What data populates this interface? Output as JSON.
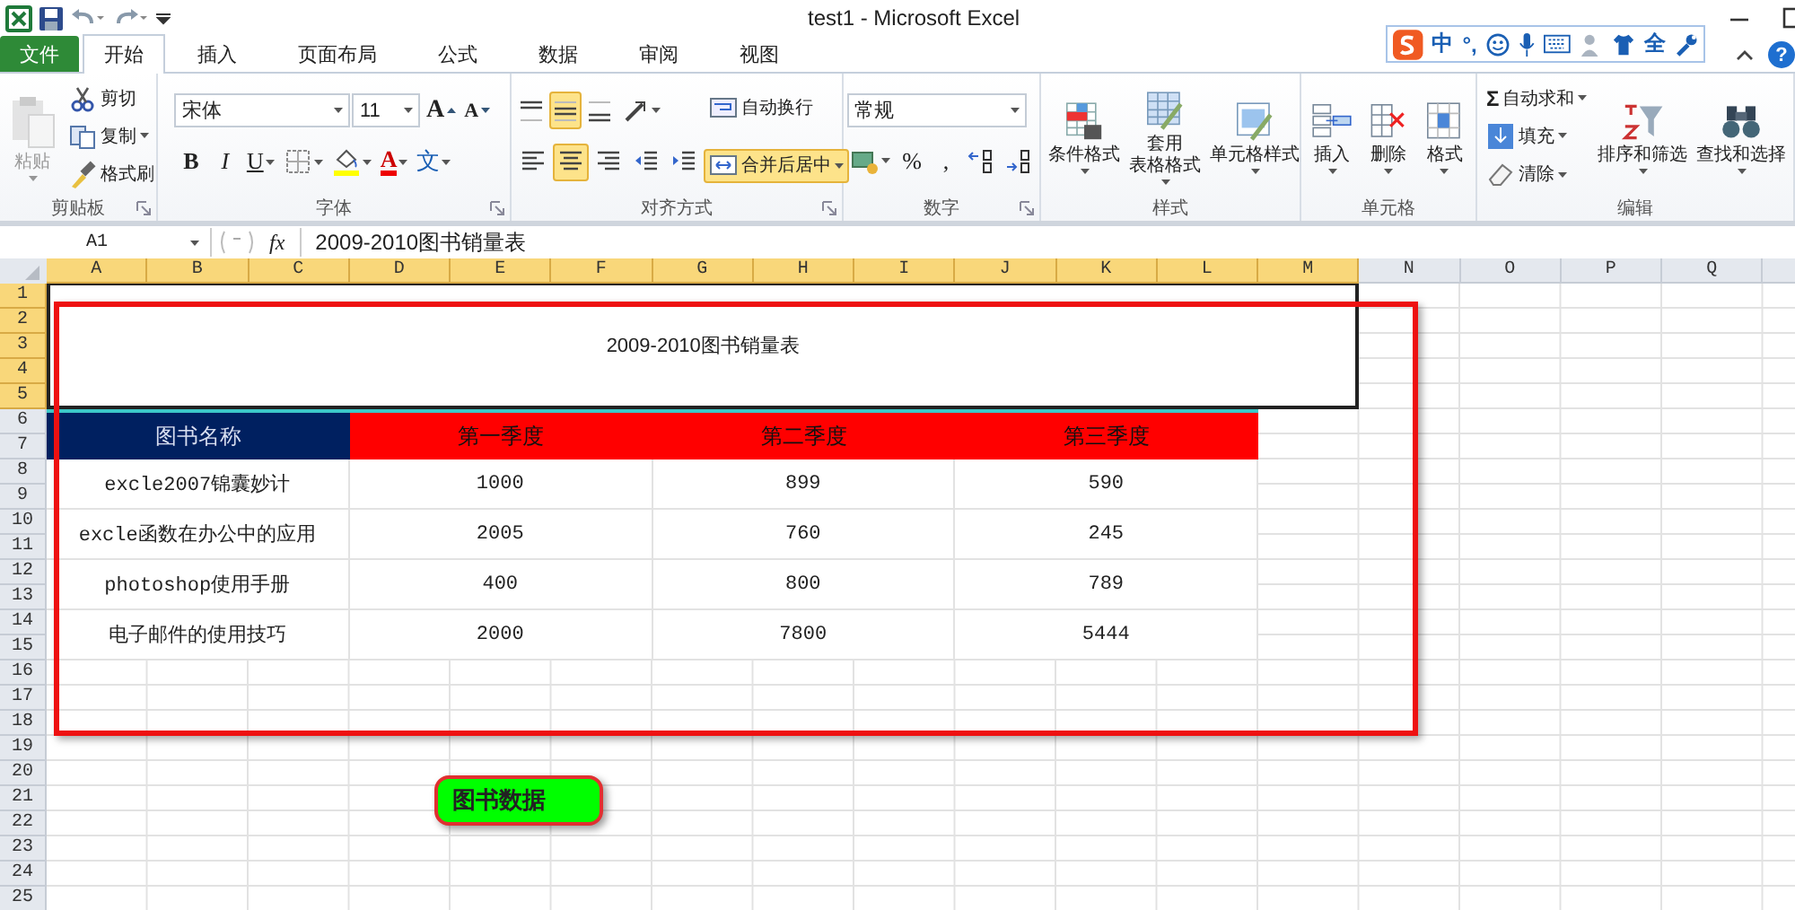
{
  "window": {
    "title": "test1 - Microsoft Excel"
  },
  "ime_toolbar": {
    "items": [
      "中",
      "°,",
      "全"
    ]
  },
  "help": {
    "text": "?"
  },
  "tabs": [
    {
      "label": "文件",
      "kind": "file",
      "selected": false
    },
    {
      "label": "开始",
      "kind": "tab",
      "selected": true
    },
    {
      "label": "插入",
      "kind": "tab",
      "selected": false
    },
    {
      "label": "页面布局",
      "kind": "tab",
      "selected": false
    },
    {
      "label": "公式",
      "kind": "tab",
      "selected": false
    },
    {
      "label": "数据",
      "kind": "tab",
      "selected": false
    },
    {
      "label": "审阅",
      "kind": "tab",
      "selected": false
    },
    {
      "label": "视图",
      "kind": "tab",
      "selected": false
    }
  ],
  "ribbon": [
    {
      "label": "剪贴板",
      "launcher": true,
      "stacks": [
        [
          [
            {
              "kind": "large",
              "label": "粘贴",
              "disabled": true,
              "dropdown": true
            }
          ]
        ],
        [
          [
            {
              "kind": "small",
              "label": "剪切"
            }
          ],
          [
            {
              "kind": "small",
              "label": "复制",
              "dropdown": true
            }
          ],
          [
            {
              "kind": "small",
              "label": "格式刷"
            }
          ]
        ]
      ]
    },
    {
      "label": "字体",
      "launcher": true,
      "stacks": [
        [
          [
            {
              "kind": "font-combo",
              "value": "宋体"
            },
            {
              "kind": "size-combo",
              "value": "11"
            },
            {
              "kind": "tool",
              "text": "A"
            },
            {
              "kind": "tool",
              "text": "A"
            }
          ],
          [
            {
              "kind": "tool",
              "text": "B"
            },
            {
              "kind": "tool",
              "text": "I"
            },
            {
              "kind": "tool",
              "text": "U",
              "dropdown": true
            },
            {
              "kind": "tool",
              "dropdown": true
            },
            {
              "kind": "tool",
              "dropdown": true
            },
            {
              "kind": "tool",
              "text": "A",
              "dropdown": true
            },
            {
              "kind": "tool",
              "text": "文",
              "dropdown": true
            }
          ]
        ]
      ]
    },
    {
      "label": "对齐方式",
      "launcher": true,
      "stacks": [
        [
          [
            {
              "kind": "tool",
              "selected": false
            },
            {
              "kind": "tool",
              "selected": true
            },
            {
              "kind": "tool",
              "selected": false
            },
            {
              "kind": "tool",
              "selected": false,
              "dropdown": true
            }
          ],
          [
            {
              "kind": "tool",
              "selected": false
            },
            {
              "kind": "tool",
              "selected": true
            },
            {
              "kind": "tool",
              "selected": false
            },
            {
              "kind": "tool",
              "selected": false
            },
            {
              "kind": "tool",
              "selected": false
            }
          ]
        ],
        [
          [
            {
              "kind": "small",
              "label": "自动换行",
              "selected": false
            }
          ],
          [
            {
              "kind": "small",
              "label": "合并后居中",
              "selected": true,
              "dropdown": true
            }
          ]
        ]
      ]
    },
    {
      "label": "数字",
      "launcher": true,
      "stacks": [
        [
          [
            {
              "kind": "number-combo",
              "value": "常规"
            }
          ],
          [
            {
              "kind": "tool",
              "dropdown": true
            },
            {
              "kind": "tool",
              "text": "%"
            },
            {
              "kind": "tool",
              "text": ","
            },
            {
              "kind": "tool"
            },
            {
              "kind": "tool"
            }
          ]
        ]
      ]
    },
    {
      "label": "样式",
      "launcher": false,
      "stacks": [
        [
          [
            {
              "kind": "large",
              "label": "条件格式",
              "dropdown": true
            }
          ]
        ],
        [
          [
            {
              "kind": "large",
              "label": [
                "套用",
                "表格格式"
              ],
              "dropdown": true
            }
          ]
        ],
        [
          [
            {
              "kind": "large",
              "label": "单元格样式",
              "dropdown": true
            }
          ]
        ]
      ]
    },
    {
      "label": "单元格",
      "launcher": false,
      "stacks": [
        [
          [
            {
              "kind": "large",
              "label": "插入",
              "dropdown": true
            }
          ]
        ],
        [
          [
            {
              "kind": "large",
              "label": "删除",
              "dropdown": true
            }
          ]
        ],
        [
          [
            {
              "kind": "large",
              "label": "格式",
              "dropdown": true
            }
          ]
        ]
      ]
    },
    {
      "label": "编辑",
      "launcher": false,
      "stacks": [
        [
          [
            {
              "kind": "small",
              "label": "自动求和",
              "glyph": "Σ",
              "dropdown": true
            }
          ],
          [
            {
              "kind": "small",
              "label": "填充",
              "dropdown": true
            }
          ],
          [
            {
              "kind": "small",
              "label": "清除",
              "dropdown": true
            }
          ]
        ],
        [
          [
            {
              "kind": "large",
              "label": "排序和筛选",
              "dropdown": true
            }
          ]
        ],
        [
          [
            {
              "kind": "large",
              "label": "查找和选择",
              "dropdown": true
            }
          ]
        ]
      ]
    }
  ],
  "formula_bar": {
    "name_box": "A1",
    "function_label": "fx",
    "formula": "2009-2010图书销量表"
  },
  "sheet": {
    "columns": [
      {
        "label": "A",
        "selected": true
      },
      {
        "label": "B",
        "selected": true
      },
      {
        "label": "C",
        "selected": true
      },
      {
        "label": "D",
        "selected": true
      },
      {
        "label": "E",
        "selected": true
      },
      {
        "label": "F",
        "selected": true
      },
      {
        "label": "G",
        "selected": true
      },
      {
        "label": "H",
        "selected": true
      },
      {
        "label": "I",
        "selected": true
      },
      {
        "label": "J",
        "selected": true
      },
      {
        "label": "K",
        "selected": true
      },
      {
        "label": "L",
        "selected": true
      },
      {
        "label": "M",
        "selected": true
      },
      {
        "label": "N",
        "selected": false
      },
      {
        "label": "O",
        "selected": false
      },
      {
        "label": "P",
        "selected": false
      },
      {
        "label": "Q",
        "selected": false
      }
    ],
    "rows": [
      {
        "label": "1",
        "selected": true
      },
      {
        "label": "2",
        "selected": true
      },
      {
        "label": "3",
        "selected": true
      },
      {
        "label": "4",
        "selected": true
      },
      {
        "label": "5",
        "selected": true
      },
      {
        "label": "6",
        "selected": false
      },
      {
        "label": "7",
        "selected": false
      },
      {
        "label": "8",
        "selected": false
      },
      {
        "label": "9",
        "selected": false
      },
      {
        "label": "10",
        "selected": false
      },
      {
        "label": "11",
        "selected": false
      },
      {
        "label": "12",
        "selected": false
      },
      {
        "label": "13",
        "selected": false
      },
      {
        "label": "14",
        "selected": false
      },
      {
        "label": "15",
        "selected": false
      },
      {
        "label": "16",
        "selected": false
      },
      {
        "label": "17",
        "selected": false
      },
      {
        "label": "18",
        "selected": false
      },
      {
        "label": "19",
        "selected": false
      },
      {
        "label": "20",
        "selected": false
      },
      {
        "label": "21",
        "selected": false
      },
      {
        "label": "22",
        "selected": false
      },
      {
        "label": "23",
        "selected": false
      },
      {
        "label": "24",
        "selected": false
      },
      {
        "label": "25",
        "selected": false
      }
    ],
    "title": "2009-2010图书销量表",
    "header": [
      {
        "text": "图书名称",
        "color": "#002060"
      },
      {
        "text": "第一季度",
        "color": "#ff0000"
      },
      {
        "text": "第二季度",
        "color": "#ff0000"
      },
      {
        "text": "第三季度",
        "color": "#ff0000"
      }
    ],
    "data": [
      {
        "cells": [
          "excle2007锦囊妙计",
          "1000",
          "899",
          "590"
        ]
      },
      {
        "cells": [
          "excle函数在办公中的应用",
          "2005",
          "760",
          "245"
        ]
      },
      {
        "cells": [
          "photoshop使用手册",
          "400",
          "800",
          "789"
        ]
      },
      {
        "cells": [
          "电子邮件的使用技巧",
          "2000",
          "7800",
          "5444"
        ]
      }
    ],
    "shape": {
      "text": "图书数据"
    }
  }
}
